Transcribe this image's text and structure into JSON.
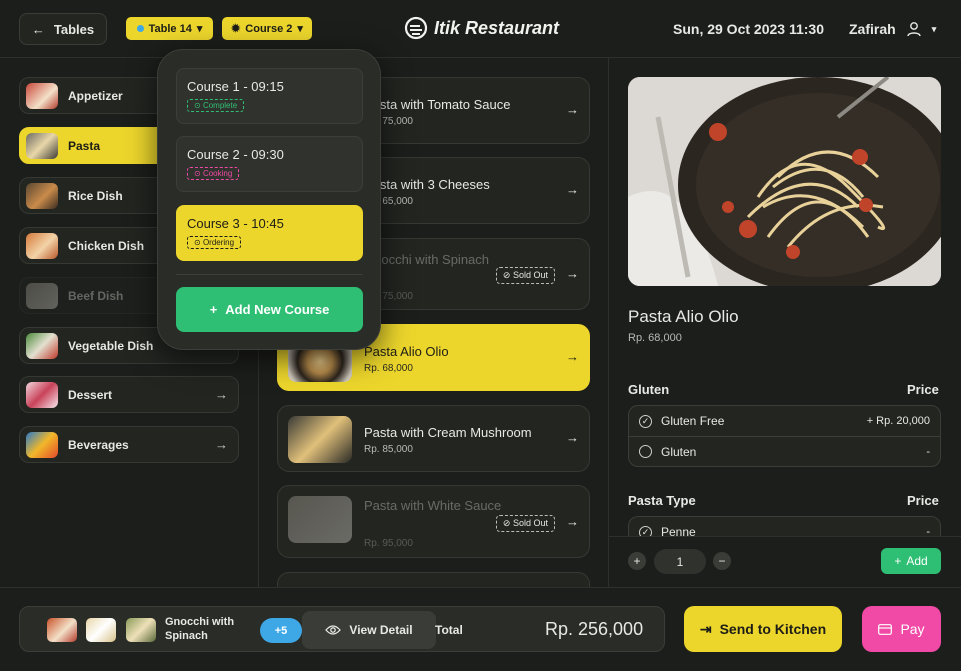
{
  "header": {
    "back_label": "Tables",
    "table_label": "Table 14",
    "course_label": "Course 2",
    "brand": "Itik Restaurant",
    "datetime": "Sun, 29 Oct 2023 11:30",
    "user": "Zafirah"
  },
  "categories": [
    {
      "label": "Appetizer"
    },
    {
      "label": "Pasta"
    },
    {
      "label": "Rice Dish"
    },
    {
      "label": "Chicken Dish"
    },
    {
      "label": "Beef Dish"
    },
    {
      "label": "Vegetable Dish"
    },
    {
      "label": "Dessert"
    },
    {
      "label": "Beverages"
    }
  ],
  "dishes": [
    {
      "name": "Pasta with Tomato Sauce",
      "price": "Rp. 75,000"
    },
    {
      "name": "Pasta with 3 Cheeses",
      "price": "Rp. 65,000"
    },
    {
      "name": "Gnocchi with Spinach",
      "price": "Rp. 75,000",
      "status": "Sold Out"
    },
    {
      "name": "Pasta Alio Olio",
      "price": "Rp. 68,000"
    },
    {
      "name": "Pasta with Cream Mushroom",
      "price": "Rp. 85,000"
    },
    {
      "name": "Pasta with White Sauce",
      "price": "Rp. 95,000",
      "status": "Sold Out"
    }
  ],
  "courses_popup": {
    "courses": [
      {
        "label": "Course 1 - 09:15",
        "status": "Complete",
        "status_color": "#2fbf74"
      },
      {
        "label": "Course 2 - 09:30",
        "status": "Cooking",
        "status_color": "#f04aa6"
      },
      {
        "label": "Course 3 - 10:45",
        "status": "Ordering",
        "status_color": "#1d1d17"
      }
    ],
    "add_label": "Add New Course"
  },
  "detail": {
    "name": "Pasta Alio Olio",
    "price": "Rp. 68,000",
    "gluten_title": "Gluten",
    "price_col": "Price",
    "gluten_options": [
      {
        "label": "Gluten Free",
        "price": "+ Rp. 20,000",
        "selected": true
      },
      {
        "label": "Gluten",
        "price": "-",
        "selected": false
      }
    ],
    "pasta_type_title": "Pasta Type",
    "pasta_options": [
      {
        "label": "Penne",
        "price": "-",
        "selected": true
      }
    ],
    "quantity": "1",
    "add_label": "Add"
  },
  "cart": {
    "last_item": "Gnocchi with Spinach",
    "more_count": "+5",
    "view_detail": "View Detail",
    "total_label": "Total",
    "total": "Rp. 256,000"
  },
  "actions": {
    "send_label": "Send to Kitchen",
    "pay_label": "Pay"
  },
  "colors": {
    "accent_yellow": "#ecd62c",
    "green": "#2fbf74",
    "pink": "#f04aa6",
    "blue": "#3ea8e6",
    "background": "#1c1e1b"
  }
}
